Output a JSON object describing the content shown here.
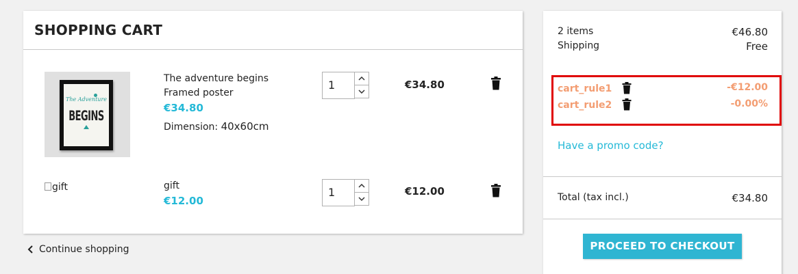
{
  "cart": {
    "title": "SHOPPING CART",
    "items": [
      {
        "name": "The adventure begins",
        "subtitle": "Framed poster",
        "price": "€34.80",
        "attribute_label": "Dimension:",
        "attribute_value": "40x60cm",
        "quantity": "1",
        "line_total": "€34.80",
        "image_alt": "",
        "image_art_script": "The Adventure",
        "image_art_word": "BEGINS"
      },
      {
        "name": "gift",
        "price": "€12.00",
        "quantity": "1",
        "line_total": "€12.00",
        "image_alt": "gift"
      }
    ],
    "continue_label": "Continue shopping"
  },
  "summary": {
    "items_label": "2 items",
    "items_value": "€46.80",
    "shipping_label": "Shipping",
    "shipping_value": "Free",
    "discounts": [
      {
        "name": "cart_rule1",
        "value": "-€12.00"
      },
      {
        "name": "cart_rule2",
        "value": "-0.00%"
      }
    ],
    "promo_link": "Have a promo code?",
    "total_label": "Total (tax incl.)",
    "total_value": "€34.80",
    "checkout_label": "PROCEED TO CHECKOUT"
  },
  "colors": {
    "accent": "#24b9d7",
    "button": "#2fb5d2",
    "discount": "#f39d72",
    "highlight_border": "#e00000",
    "background": "#f1f1f1"
  },
  "icons": {
    "delete": "trash-icon",
    "qty_up": "chevron-up-icon",
    "qty_down": "chevron-down-icon",
    "back": "chevron-left-icon"
  }
}
